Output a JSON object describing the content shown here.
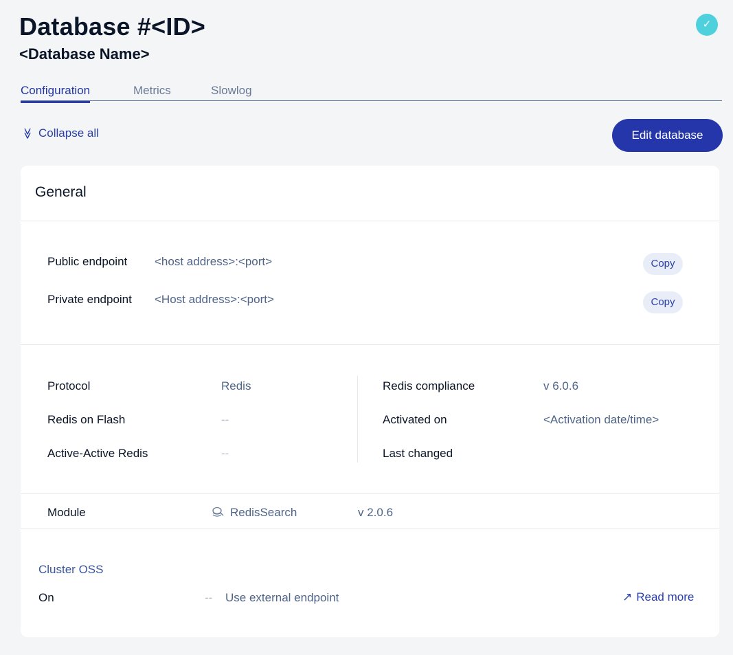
{
  "header": {
    "title": "Database #<ID>",
    "subtitle": "<Database Name>",
    "status_icon": "check-icon",
    "status_glyph": "✓"
  },
  "tabs": [
    {
      "label": "Configuration",
      "active": true
    },
    {
      "label": "Metrics",
      "active": false
    },
    {
      "label": "Slowlog",
      "active": false
    }
  ],
  "toolbar": {
    "collapse_label": "Collapse all",
    "collapse_glyph": "≫",
    "edit_label": "Edit database"
  },
  "general": {
    "title": "General",
    "endpoints": [
      {
        "label": "Public endpoint",
        "value": "<host address>:<port>",
        "copy_label": "Copy"
      },
      {
        "label": "Private endpoint",
        "value": "<Host address>:<port>",
        "copy_label": "Copy"
      }
    ],
    "left_props": [
      {
        "label": "Protocol",
        "value": "Redis"
      },
      {
        "label": "Redis on Flash",
        "value": "--"
      },
      {
        "label": "Active-Active Redis",
        "value": "--"
      }
    ],
    "right_props": [
      {
        "label": "Redis compliance",
        "value": "v 6.0.6"
      },
      {
        "label": "Activated on",
        "value": "<Activation date/time>"
      },
      {
        "label": "Last changed",
        "value": ""
      }
    ],
    "module": {
      "label": "Module",
      "name": "RedisSearch",
      "version": "v 2.0.6"
    },
    "cluster_oss": {
      "title": "Cluster OSS",
      "state": "On",
      "dash": "--",
      "external_endpoint": "Use external endpoint",
      "read_more": "Read more",
      "read_more_glyph": "↗"
    }
  },
  "colors": {
    "primary": "#2436aa",
    "status": "#4fd1dd",
    "value_text": "#4e6488",
    "background": "#f4f5f7"
  }
}
